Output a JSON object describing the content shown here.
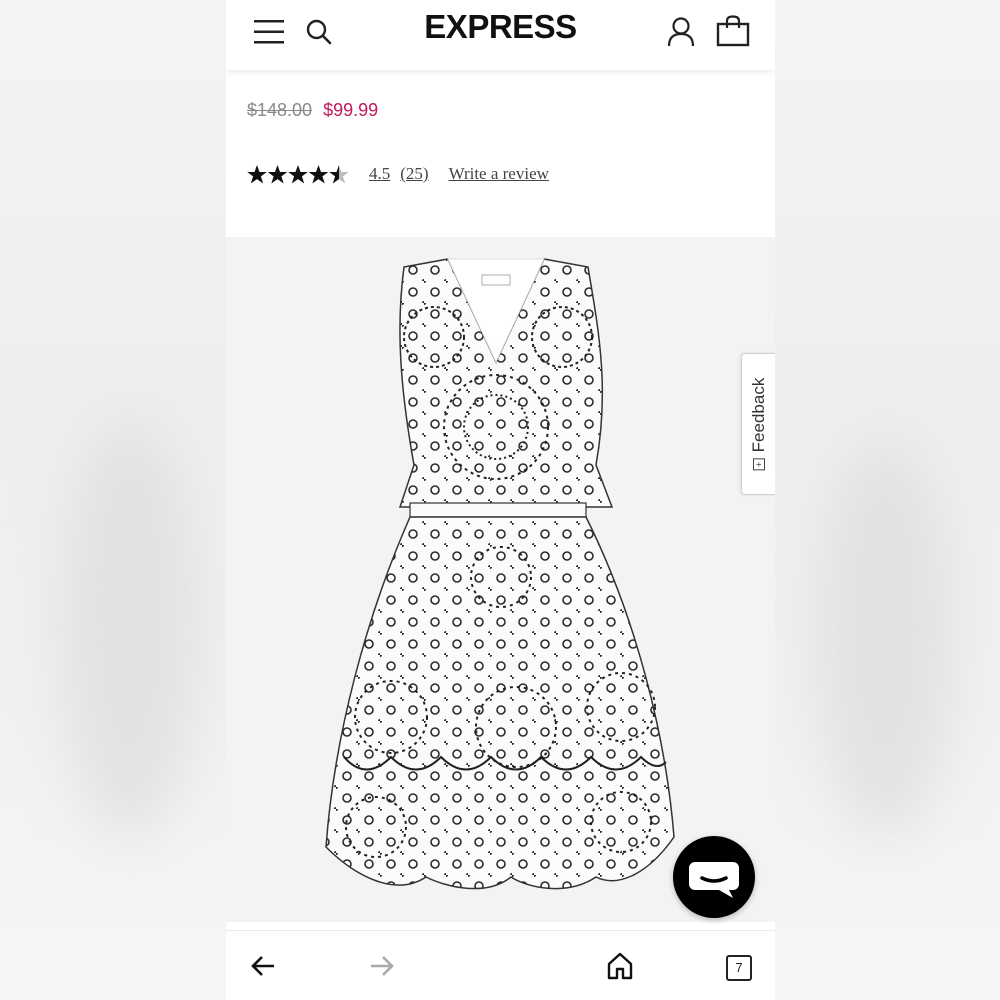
{
  "header": {
    "logo": "EXPRESS",
    "icons": [
      "menu-icon",
      "search-icon",
      "account-icon",
      "shopping-bag-icon"
    ]
  },
  "product": {
    "original_price": "$148.00",
    "sale_price": "$99.99",
    "rating": 5,
    "rating_out_of": 5,
    "rating_value": 4.5,
    "rating_label": "4.5",
    "review_count_label": "(25)",
    "write_review_label": "Write a review",
    "image_alt": "Embroidered eyelet sleeveless tiered dress"
  },
  "feedback": {
    "label": "Feedback"
  },
  "browser": {
    "tab_count": "7",
    "icons": [
      "back-arrow-icon",
      "forward-arrow-icon",
      "home-icon",
      "tabs-icon"
    ]
  },
  "colors": {
    "sale_price": "#c2185b",
    "original_price": "#8a8a8a",
    "chat_button": "#000000"
  }
}
